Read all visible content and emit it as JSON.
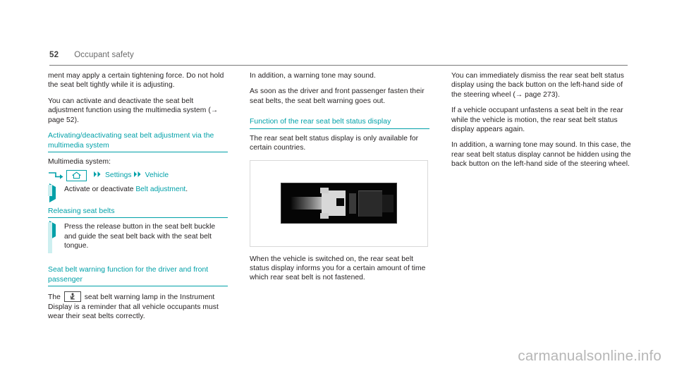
{
  "header": {
    "page_number": "52",
    "title": "Occupant safety"
  },
  "columns": {
    "left": {
      "para1": "ment may apply a certain tightening force. Do not hold the seat belt tightly while it is adjusting.",
      "para2_a": "You can activate and deactivate the seat belt adjustment function using the multimedia system (",
      "para2_ref": "→ page 52",
      "para2_b": ").",
      "heading1": "Activating/deactivating seat belt adjustment via the multimedia system",
      "multimedia_label": "Multimedia system:",
      "nav": {
        "home_icon": "home-icon",
        "arrow_icon": "hook-arrow-icon",
        "chevron_icon": "double-chevron-icon",
        "item1": "Settings",
        "item2": "Vehicle"
      },
      "step1_a": "Activate or deactivate ",
      "step1_link": "Belt adjustment",
      "step1_b": ".",
      "heading2": "Releasing seat belts",
      "step2": "Press the release button in the seat belt buckle and guide the seat belt back with the seat belt tongue.",
      "heading3": "Seat belt warning function for the driver and front passenger",
      "para3_a": "The ",
      "para3_icon": "seatbelt-warning-lamp-icon",
      "para3_b": " seat belt warning lamp in the Instrument Display is a reminder that all vehicle occupants must wear their seat belts correctly."
    },
    "middle": {
      "para1": "In addition, a warning tone may sound.",
      "para2": "As soon as the driver and front passenger fasten their seat belts, the seat belt warning goes out.",
      "heading1": "Function of the rear seat belt status display",
      "para3": "The rear seat belt status display is only available for certain countries.",
      "figure_name": "rear-seat-belt-status-display-figure",
      "para4": "When the vehicle is switched on, the rear seat belt status display informs you for a certain amount of time which rear seat belt is not fastened."
    },
    "right": {
      "para1_a": "You can immediately dismiss the rear seat belt status display using the back button on the left-hand side of the steering wheel (",
      "para1_ref": "→ page 273",
      "para1_b": ").",
      "para2": "If a vehicle occupant unfastens a seat belt in the rear while the vehicle is motion, the rear seat belt status display appears again.",
      "para3": "In addition, a warning tone may sound. In this case, the rear seat belt status display cannot be hidden using the back button on the left-hand side of the steering wheel."
    }
  },
  "watermark": "carmanualsonline.info",
  "colors": {
    "accent_teal": "#00a0a8",
    "step_bar": "#cdeff0",
    "body_text": "#231f20",
    "header_text": "#6a6a6a",
    "watermark": "#b6b6b6"
  }
}
